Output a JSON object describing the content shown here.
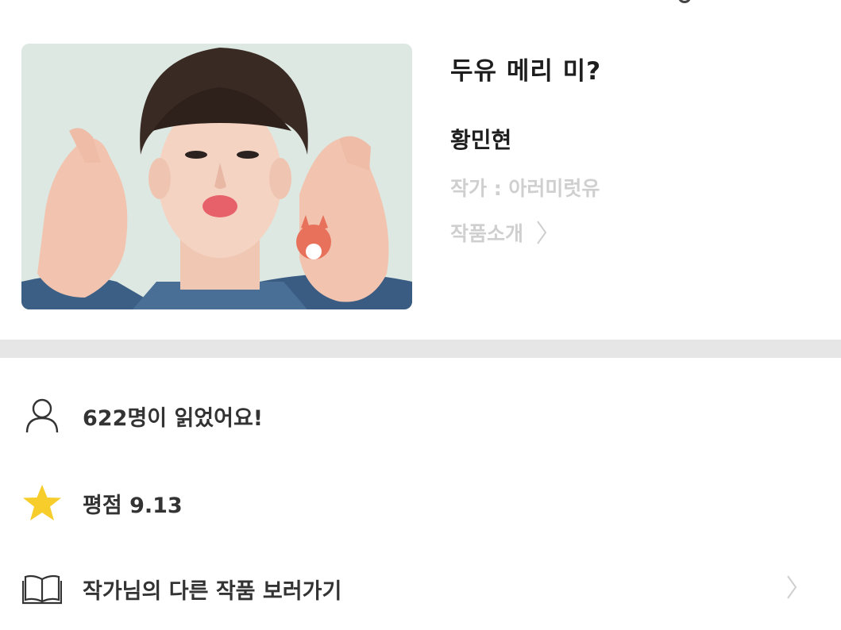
{
  "work": {
    "title": "두유 메리 미?",
    "subtitle": "황민현",
    "author_line": "작가 : 아러미럿유",
    "intro_label": "작품소개"
  },
  "stats": {
    "readers_text": "622명이 읽었어요!",
    "rating_text": "평점 9.13",
    "other_works_label": "작가님의 다른 작품 보러가기"
  },
  "icons": {
    "readers": "person-icon",
    "rating": "star-icon",
    "other_works": "book-icon",
    "chevron": "chevron-right-icon"
  },
  "colors": {
    "star": "#f6cd2a",
    "muted_text": "#cfcfcf",
    "divider": "#e6e6e6"
  }
}
